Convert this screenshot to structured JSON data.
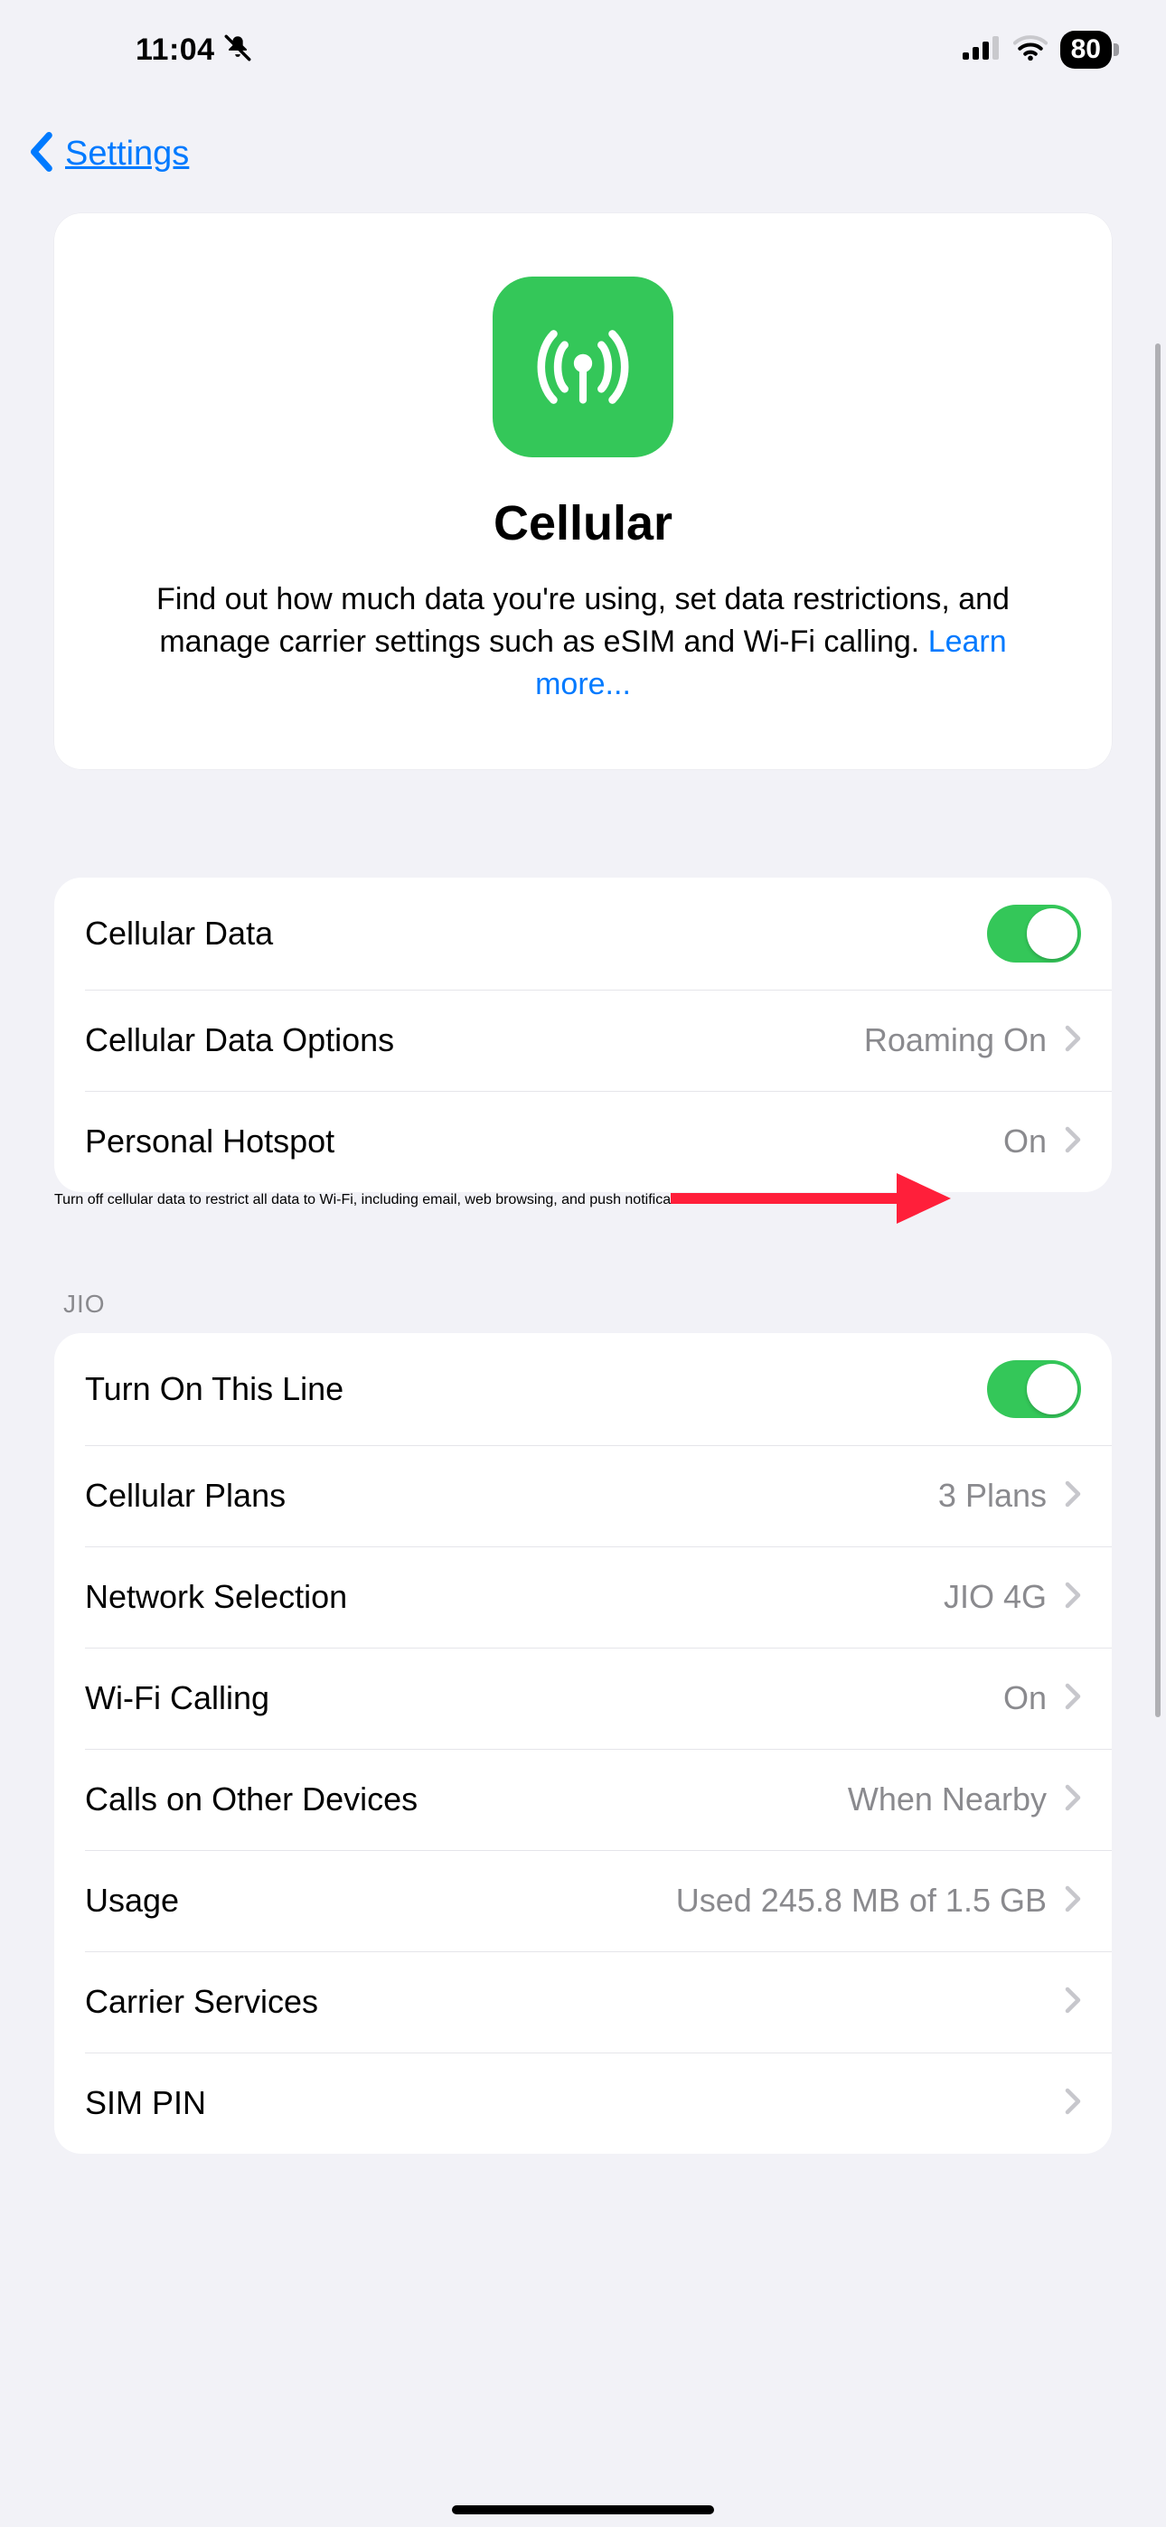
{
  "status": {
    "time": "11:04",
    "silent": true,
    "signal_bars": 3,
    "wifi": true,
    "battery_percent": "80"
  },
  "nav": {
    "back_label": "Settings"
  },
  "hero": {
    "icon": "cellular-icon",
    "title": "Cellular",
    "description": "Find out how much data you're using, set data restrictions, and manage carrier settings such as eSIM and Wi-Fi calling. ",
    "learn_more": "Learn more..."
  },
  "group1": {
    "rows": [
      {
        "label": "Cellular Data",
        "type": "switch",
        "on": true
      },
      {
        "label": "Cellular Data Options",
        "type": "nav",
        "value": "Roaming On"
      },
      {
        "label": "Personal Hotspot",
        "type": "nav",
        "value": "On"
      }
    ],
    "footer": "Turn off cellular data to restrict all data to Wi-Fi, including email, web browsing, and push notifications."
  },
  "carrier_section": {
    "header": "JIO",
    "rows": [
      {
        "label": "Turn On This Line",
        "type": "switch",
        "on": true
      },
      {
        "label": "Cellular Plans",
        "type": "nav",
        "value": "3 Plans"
      },
      {
        "label": "Network Selection",
        "type": "nav",
        "value": "JIO 4G"
      },
      {
        "label": "Wi-Fi Calling",
        "type": "nav",
        "value": "On"
      },
      {
        "label": "Calls on Other Devices",
        "type": "nav",
        "value": "When Nearby"
      },
      {
        "label": "Usage",
        "type": "nav",
        "value": "Used 245.8 MB of 1.5 GB"
      },
      {
        "label": "Carrier Services",
        "type": "nav",
        "value": ""
      },
      {
        "label": "SIM PIN",
        "type": "nav",
        "value": ""
      }
    ]
  },
  "colors": {
    "accent": "#007aff",
    "switch_on": "#34c759",
    "secondary_text": "#8a8a8e",
    "bg": "#f2f2f7"
  },
  "annotation": {
    "arrow_color": "#ff1f3a"
  }
}
